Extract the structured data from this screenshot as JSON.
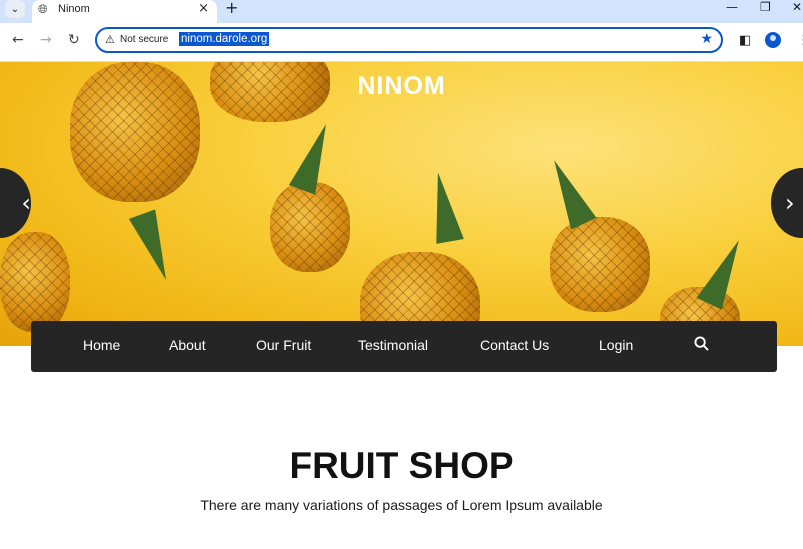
{
  "browser": {
    "tab_title": "Ninom",
    "security_label": "Not secure",
    "url": "ninom.darole.org",
    "icons": [
      "tab-search-icon",
      "globe-icon",
      "close-icon",
      "plus-icon",
      "minimize-icon",
      "restore-icon",
      "close-window-icon",
      "back-icon",
      "forward-icon",
      "reload-icon",
      "warning-icon",
      "star-icon",
      "sidebar-icon",
      "profile-icon",
      "more-icon"
    ],
    "accent_color": "#0b57d0"
  },
  "hero": {
    "brand": "NINOM",
    "prev_icon": "‹",
    "next_icon": "›"
  },
  "nav": {
    "items": [
      "Home",
      "About",
      "Our Fruit",
      "Testimonial",
      "Contact Us",
      "Login"
    ],
    "search_icon": "search-icon"
  },
  "section": {
    "title": "FRUIT SHOP",
    "subtitle": "There are many variations of passages of Lorem Ipsum available"
  }
}
